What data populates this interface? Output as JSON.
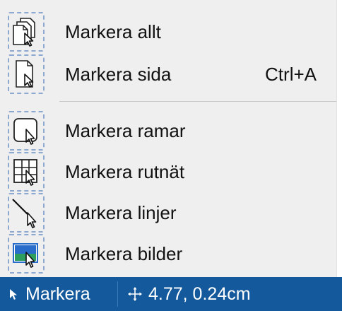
{
  "menu": {
    "items": [
      {
        "label": "Markera allt",
        "shortcut": "",
        "icon": "select-all-icon"
      },
      {
        "label": "Markera sida",
        "shortcut": "Ctrl+A",
        "icon": "select-page-icon"
      },
      {
        "label": "Markera ramar",
        "shortcut": "",
        "icon": "select-frames-icon"
      },
      {
        "label": "Markera rutnät",
        "shortcut": "",
        "icon": "select-grid-icon"
      },
      {
        "label": "Markera linjer",
        "shortcut": "",
        "icon": "select-lines-icon"
      },
      {
        "label": "Markera bilder",
        "shortcut": "",
        "icon": "select-images-icon"
      }
    ]
  },
  "statusbar": {
    "tool_label": "Markera",
    "tool_icon": "pointer-arrow-icon",
    "position_icon": "move-crosshair-icon",
    "position_text": "4.77, 0.24cm"
  },
  "colors": {
    "menu_background": "#efefef",
    "icon_dash_border": "#8da9cf",
    "statusbar_background": "#14599c",
    "image_icon_green": "#2e9e5e",
    "image_icon_blue": "#2a6cc9"
  }
}
